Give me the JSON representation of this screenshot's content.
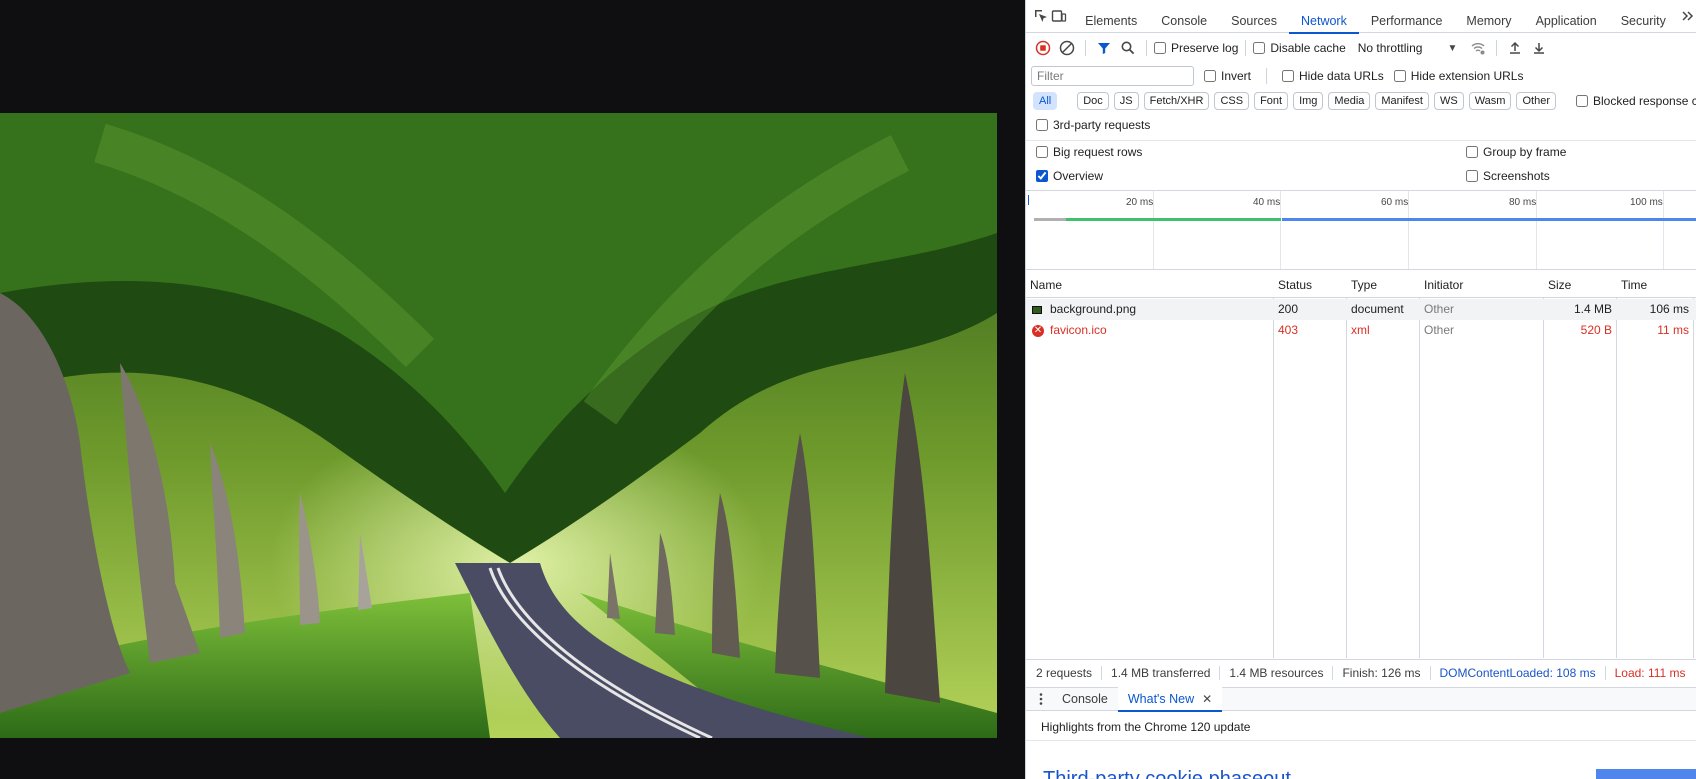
{
  "viewer": {
    "image_alt": "Tree tunnel over a country road"
  },
  "devtools": {
    "tabs": [
      "Elements",
      "Console",
      "Sources",
      "Network",
      "Performance",
      "Memory",
      "Application",
      "Security"
    ],
    "active_tab": "Network",
    "toolbar": {
      "preserve_log": "Preserve log",
      "disable_cache": "Disable cache",
      "throttling": "No throttling"
    },
    "filter": {
      "placeholder": "Filter",
      "invert": "Invert",
      "hide_data_urls": "Hide data URLs",
      "hide_extension_urls": "Hide extension URLs"
    },
    "type_chips": [
      "All",
      "Doc",
      "JS",
      "Fetch/XHR",
      "CSS",
      "Font",
      "Img",
      "Media",
      "Manifest",
      "WS",
      "Wasm",
      "Other"
    ],
    "blocked_cookies": "Blocked response cookies",
    "third_party": "3rd-party requests",
    "settings": {
      "big_rows": "Big request rows",
      "overview": "Overview",
      "group_by_frame": "Group by frame",
      "screenshots": "Screenshots"
    },
    "overview_ticks": [
      "20 ms",
      "40 ms",
      "60 ms",
      "80 ms",
      "100 ms"
    ],
    "table": {
      "headers": [
        "Name",
        "Status",
        "Type",
        "Initiator",
        "Size",
        "Time"
      ],
      "rows": [
        {
          "name": "background.png",
          "status": "200",
          "type": "document",
          "initiator": "Other",
          "size": "1.4 MB",
          "time": "106 ms",
          "error": false
        },
        {
          "name": "favicon.ico",
          "status": "403",
          "type": "xml",
          "initiator": "Other",
          "size": "520 B",
          "time": "11 ms",
          "error": true
        }
      ]
    },
    "summary": {
      "requests": "2 requests",
      "transferred": "1.4 MB transferred",
      "resources": "1.4 MB resources",
      "finish": "Finish: 126 ms",
      "dcl": "DOMContentLoaded: 108 ms",
      "load": "Load: 111 ms"
    },
    "drawer": {
      "tabs": [
        "Console",
        "What's New"
      ],
      "active": "What's New",
      "highlights": "Highlights from the Chrome 120 update",
      "heading": "Third-party cookie phaseout"
    },
    "colors": {
      "accent": "#0b57d0",
      "error": "#d93025",
      "dcl_blue": "#1a55c7"
    }
  }
}
